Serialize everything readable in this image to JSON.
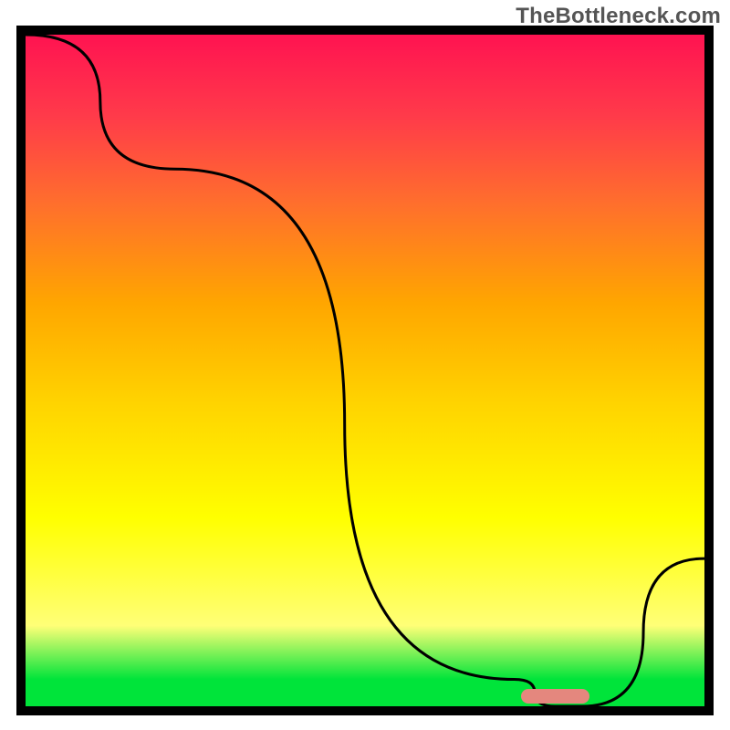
{
  "watermark": "TheBottleneck.com",
  "chart_data": {
    "type": "line",
    "title": "",
    "xlabel": "",
    "ylabel": "",
    "xlim": [
      0,
      100
    ],
    "ylim": [
      0,
      100
    ],
    "x": [
      0,
      22,
      72,
      78,
      82,
      100
    ],
    "values": [
      100,
      80,
      4,
      0,
      0,
      22
    ],
    "marker": {
      "x_start": 73,
      "x_end": 83,
      "y": 1.5
    },
    "gradient_stops": [
      {
        "pos": 0,
        "color": "#00e43a"
      },
      {
        "pos": 4,
        "color": "#00e43a"
      },
      {
        "pos": 12,
        "color": "#ffff77"
      },
      {
        "pos": 28,
        "color": "#ffff00"
      },
      {
        "pos": 45,
        "color": "#ffd400"
      },
      {
        "pos": 60,
        "color": "#ffa600"
      },
      {
        "pos": 75,
        "color": "#ff6e2d"
      },
      {
        "pos": 88,
        "color": "#ff3a4a"
      },
      {
        "pos": 100,
        "color": "#ff1351"
      }
    ]
  },
  "colors": {
    "curve": "#000000",
    "marker": "#e4877e",
    "frame": "#000000",
    "watermark": "#555555"
  }
}
